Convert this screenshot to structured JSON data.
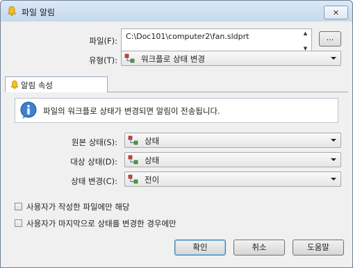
{
  "window": {
    "title": "파일 알림",
    "close_glyph": "✕"
  },
  "file": {
    "label": "파일(F):",
    "value": "C:\\Doc101\\computer2\\fan.sldprt",
    "browse_label": "..."
  },
  "type": {
    "label": "유형(T):",
    "value": "워크플로 상태 변경",
    "icon": "workflow-state-icon"
  },
  "tab": {
    "label": "알림 속성",
    "icon": "bell-icon"
  },
  "info": {
    "text": "파일의 워크플로 상태가 변경되면 알림이 전송됩니다.",
    "icon": "info-icon"
  },
  "original_state": {
    "label": "원본 상태(S):",
    "value": "상태"
  },
  "target_state": {
    "label": "대상 상태(D):",
    "value": "상태"
  },
  "state_change": {
    "label": "상태 변경(C):",
    "value": "전이"
  },
  "checkboxes": [
    {
      "label": "사용자가 작성한 파일에만 해당",
      "checked": false
    },
    {
      "label": "사용자가 마지막으로 상태를 변경한 경우에만",
      "checked": false
    }
  ],
  "buttons": {
    "ok": "확인",
    "cancel": "취소",
    "help": "도움말"
  },
  "colors": {
    "title_gradient_top": "#dbe8f6",
    "title_gradient_bottom": "#c6d9ee",
    "client_bg": "#f0f0f0",
    "default_button_border": "#3c7fb1"
  }
}
